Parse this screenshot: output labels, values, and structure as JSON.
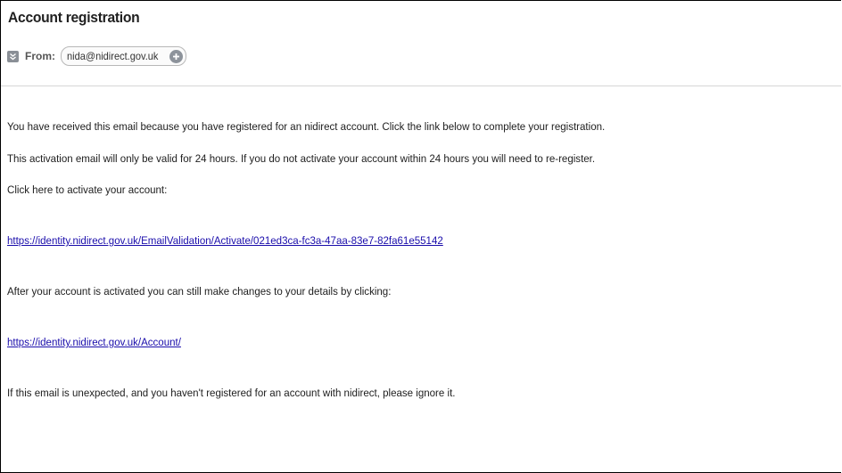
{
  "email": {
    "subject": "Account registration",
    "from_label": "From:",
    "sender": "nida@nidirect.gov.uk",
    "icons": {
      "toggle": "chevron-down-icon",
      "add": "add-contact-icon"
    }
  },
  "body": {
    "intro": "You have received this email because you have registered for an nidirect account. Click the link below to complete your registration.",
    "validity": "This activation email will only be valid for 24 hours. If you do not activate your account within 24 hours you will need to re-register.",
    "activate_prompt": "Click here to activate your account:",
    "activate_link": "https://identity.nidirect.gov.uk/EmailValidation/Activate/021ed3ca-fc3a-47aa-83e7-82fa61e55142",
    "changes_prompt": "After your account is activated you can still make changes to your details by clicking:",
    "account_link": "https://identity.nidirect.gov.uk/Account/",
    "ignore_note": "If this email is unexpected, and you haven't registered for an account with nidirect, please ignore it."
  },
  "colors": {
    "link": "#1a0dab",
    "text": "#202020",
    "icon": "#8a8f96"
  }
}
